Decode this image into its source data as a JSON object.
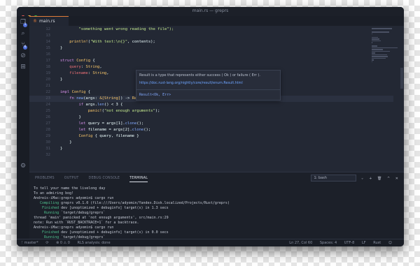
{
  "window": {
    "title": "main.rs — greprs",
    "lights": [
      "#fc615d",
      "#fdbc40",
      "#34c84a"
    ]
  },
  "activity_bar": {
    "icons": [
      {
        "name": "files-icon",
        "glyph": "❐",
        "badge": "1"
      },
      {
        "name": "search-icon",
        "glyph": "⌕",
        "badge": null
      },
      {
        "name": "source-control-icon",
        "glyph": "⑂",
        "badge": "6"
      },
      {
        "name": "debug-icon",
        "glyph": "⊘",
        "badge": null
      },
      {
        "name": "extensions-icon",
        "glyph": "⊞",
        "badge": null
      },
      {
        "name": "settings-gear-icon",
        "glyph": "⚙",
        "badge": null
      }
    ]
  },
  "tabs": [
    {
      "label": "main.rs",
      "icon": "rust-file-icon"
    }
  ],
  "editor": {
    "lines": [
      {
        "n": "12",
        "tokens": [
          {
            "t": "        \"something went wrong reading the file\");",
            "c": "str"
          }
        ]
      },
      {
        "n": "13",
        "tokens": []
      },
      {
        "n": "14",
        "tokens": [
          {
            "t": "    ",
            "c": "id"
          },
          {
            "t": "println!",
            "c": "mac"
          },
          {
            "t": "(",
            "c": "id"
          },
          {
            "t": "\"With text:\\n{}\"",
            "c": "str"
          },
          {
            "t": ", contents);",
            "c": "id"
          }
        ]
      },
      {
        "n": "15",
        "tokens": [
          {
            "t": "}",
            "c": "id"
          }
        ]
      },
      {
        "n": "16",
        "tokens": []
      },
      {
        "n": "17",
        "tokens": [
          {
            "t": "struct ",
            "c": "kw"
          },
          {
            "t": "Config",
            "c": "ty"
          },
          {
            "t": " {",
            "c": "id"
          }
        ]
      },
      {
        "n": "18",
        "tokens": [
          {
            "t": "    query",
            "c": "fld"
          },
          {
            "t": ": ",
            "c": "id"
          },
          {
            "t": "String",
            "c": "ty"
          },
          {
            "t": ",",
            "c": "id"
          }
        ]
      },
      {
        "n": "19",
        "tokens": [
          {
            "t": "    filename",
            "c": "fld"
          },
          {
            "t": ": ",
            "c": "id"
          },
          {
            "t": "String",
            "c": "ty"
          },
          {
            "t": ",",
            "c": "id"
          }
        ]
      },
      {
        "n": "20",
        "tokens": [
          {
            "t": "}",
            "c": "id"
          }
        ]
      },
      {
        "n": "21",
        "tokens": []
      },
      {
        "n": "22",
        "tokens": [
          {
            "t": "impl ",
            "c": "kw"
          },
          {
            "t": "Config",
            "c": "ty"
          },
          {
            "t": " {",
            "c": "id"
          }
        ]
      },
      {
        "n": "23",
        "cur": true,
        "tokens": [
          {
            "t": "    fn ",
            "c": "kw"
          },
          {
            "t": "new",
            "c": "fn"
          },
          {
            "t": "(args: ",
            "c": "id"
          },
          {
            "t": "&[String]",
            "c": "ty"
          },
          {
            "t": ") -> ",
            "c": "id"
          },
          {
            "t": "Result",
            "c": "ty"
          },
          {
            "t": "<Config, &",
            "c": "id"
          },
          {
            "t": "'static str",
            "c": "kw"
          },
          {
            "t": "> {",
            "c": "id"
          }
        ]
      },
      {
        "n": "24",
        "tokens": [
          {
            "t": "        if ",
            "c": "kw"
          },
          {
            "t": "args.",
            "c": "id"
          },
          {
            "t": "len",
            "c": "fn"
          },
          {
            "t": "() < 3 {",
            "c": "id"
          }
        ]
      },
      {
        "n": "25",
        "tokens": [
          {
            "t": "            ",
            "c": "id"
          },
          {
            "t": "panic!",
            "c": "mac"
          },
          {
            "t": "(",
            "c": "id"
          },
          {
            "t": "\"not enough arguments\"",
            "c": "str"
          },
          {
            "t": ");",
            "c": "id"
          }
        ]
      },
      {
        "n": "26",
        "tokens": [
          {
            "t": "        }",
            "c": "id"
          }
        ]
      },
      {
        "n": "27",
        "tokens": [
          {
            "t": "        let ",
            "c": "kw"
          },
          {
            "t": "query = args[1].",
            "c": "id"
          },
          {
            "t": "clone",
            "c": "fn"
          },
          {
            "t": "();",
            "c": "id"
          }
        ]
      },
      {
        "n": "28",
        "tokens": [
          {
            "t": "        let ",
            "c": "kw"
          },
          {
            "t": "filename = args[2].",
            "c": "id"
          },
          {
            "t": "clone",
            "c": "fn"
          },
          {
            "t": "();",
            "c": "id"
          }
        ]
      },
      {
        "n": "29",
        "tokens": [
          {
            "t": "        ",
            "c": "id"
          },
          {
            "t": "Config",
            "c": "ty"
          },
          {
            "t": " { query, filename }",
            "c": "id"
          }
        ]
      },
      {
        "n": "30",
        "tokens": [
          {
            "t": "    }",
            "c": "id"
          }
        ]
      },
      {
        "n": "31",
        "tokens": [
          {
            "t": "}",
            "c": "id"
          }
        ]
      },
      {
        "n": "32",
        "tokens": []
      }
    ]
  },
  "hover": {
    "description": "Result  is a type that represents either success ( Ok ) or failure ( Err ).",
    "link": "https://doc.rust-lang.org/nightly/core/result/enum.Result.html",
    "signature": "Result<Ok, Err>"
  },
  "panel": {
    "tabs": [
      "PROBLEMS",
      "OUTPUT",
      "DEBUG CONSOLE",
      "TERMINAL"
    ],
    "active_tab": "TERMINAL",
    "terminal_select": "1: bash",
    "controls": [
      "+",
      "🗑",
      "^",
      "✕"
    ],
    "terminal_lines": [
      {
        "text": "To tell your name the livelong day",
        "parts": null
      },
      {
        "text": "To an admiring bog!",
        "parts": null
      },
      {
        "text": "Andreis-iMac:greprs adyomin$ cargo run",
        "parts": null
      },
      {
        "parts": [
          {
            "t": "   Compiling",
            "c": "grn"
          },
          {
            "t": " greprs v0.1.0 (file:///Users/adyomin/Yandex.Disk.localized/Projects/Rust/greprs)",
            "c": ""
          }
        ]
      },
      {
        "parts": [
          {
            "t": "    Finished",
            "c": "grn"
          },
          {
            "t": " dev [unoptimized + debuginfo] target(s) in 1.3 secs",
            "c": ""
          }
        ]
      },
      {
        "parts": [
          {
            "t": "     Running",
            "c": "grn"
          },
          {
            "t": " `target/debug/greprs`",
            "c": ""
          }
        ]
      },
      {
        "text": "thread 'main' panicked at 'not enough arguments', src/main.rs:29",
        "parts": null
      },
      {
        "text": "note: Run with `RUST_BACKTRACE=1` for a backtrace.",
        "parts": null
      },
      {
        "text": "Andreis-iMac:greprs adyomin$ cargo run",
        "parts": null
      },
      {
        "parts": [
          {
            "t": "    Finished",
            "c": "grn"
          },
          {
            "t": " dev [unoptimized + debuginfo] target(s) in 0.0 secs",
            "c": ""
          }
        ]
      },
      {
        "parts": [
          {
            "t": "     Running",
            "c": "grn"
          },
          {
            "t": " `target/debug/greprs`",
            "c": ""
          }
        ]
      },
      {
        "text": "thread 'main' panicked at 'not enough arguments', src/main.rs:29",
        "parts": null
      },
      {
        "text": "note: Run with `RUST_BACKTRACE=1` for a backtrace.",
        "parts": null
      },
      {
        "text": "Andreis-iMac:greprs adyomin$ ",
        "parts": null
      }
    ]
  },
  "status": {
    "branch": "ᚴ master*",
    "sync": "⟳",
    "problems": "⊗ 0  ⚠ 0",
    "rls": "RLS analysis: done",
    "position": "Ln 27, Col 60",
    "spaces": "Spaces: 4",
    "encoding": "UTF-8",
    "eol": "LF",
    "language": "Rust",
    "face": "☺"
  }
}
